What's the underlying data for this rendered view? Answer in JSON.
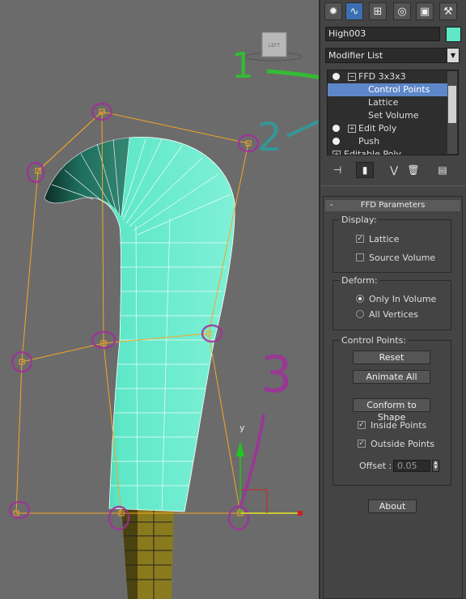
{
  "viewport": {
    "viewcube_label": "LEFT",
    "axis_y_label": "y",
    "annotations": [
      "1",
      "2",
      "3"
    ]
  },
  "command_panel": {
    "tabs": [
      {
        "name": "create",
        "icon": "sun-icon"
      },
      {
        "name": "modify",
        "icon": "modify-curve-icon"
      },
      {
        "name": "hierarchy",
        "icon": "hierarchy-icon"
      },
      {
        "name": "motion",
        "icon": "motion-icon"
      },
      {
        "name": "display",
        "icon": "display-monitor-icon"
      },
      {
        "name": "utilities",
        "icon": "hammer-icon"
      }
    ],
    "object_name": "High003",
    "object_color": "#5fe8c8",
    "modifier_list_label": "Modifier List"
  },
  "modifier_stack": {
    "items": [
      {
        "label": "FFD 3x3x3",
        "has_bulb": true,
        "expander": "−"
      },
      {
        "label": "Control Points",
        "selected": true
      },
      {
        "label": "Lattice"
      },
      {
        "label": "Set Volume"
      },
      {
        "label": "Edit Poly",
        "has_bulb": true,
        "expander": "+"
      },
      {
        "label": "Push",
        "has_bulb": true
      },
      {
        "label": "Editable Poly",
        "expander": "+"
      }
    ]
  },
  "ffd_parameters": {
    "title": "FFD Parameters",
    "collapse_symbol": "-",
    "display": {
      "label": "Display:",
      "lattice": {
        "label": "Lattice",
        "checked": true
      },
      "source_volume": {
        "label": "Source Volume",
        "checked": false
      }
    },
    "deform": {
      "label": "Deform:",
      "only_in_volume": {
        "label": "Only In Volume",
        "selected": true
      },
      "all_vertices": {
        "label": "All Vertices",
        "selected": false
      }
    },
    "control_points": {
      "label": "Control Points:",
      "reset_label": "Reset",
      "animate_all_label": "Animate All",
      "conform_label": "Conform to Shape",
      "inside_points": {
        "label": "Inside Points",
        "checked": true
      },
      "outside_points": {
        "label": "Outside Points",
        "checked": true
      },
      "offset_label": "Offset :",
      "offset_value": "0.05"
    },
    "about_label": "About"
  },
  "colors": {
    "mesh": "#5fe8c8",
    "lattice": "#f5a623",
    "selection_highlight": "#5e87c9",
    "annotation_green": "#2bc92b",
    "annotation_teal": "#2aa0a0",
    "annotation_magenta": "#a0309a"
  }
}
